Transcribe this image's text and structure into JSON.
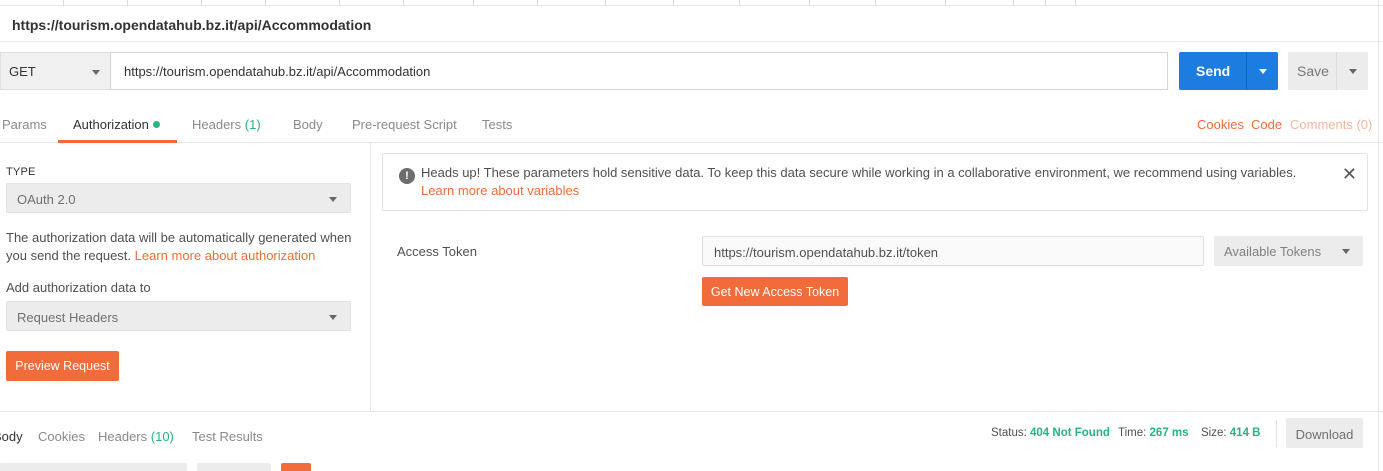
{
  "request": {
    "title": "https://tourism.opendatahub.bz.it/api/Accommodation",
    "method": "GET",
    "url": "https://tourism.opendatahub.bz.it/api/Accommodation",
    "send_label": "Send",
    "save_label": "Save"
  },
  "request_tabs": {
    "params": "Params",
    "authorization": "Authorization",
    "headers": "Headers",
    "headers_count": "(1)",
    "body": "Body",
    "prerequest": "Pre-request Script",
    "tests": "Tests",
    "cookies": "Cookies",
    "code": "Code",
    "comments": "Comments (0)"
  },
  "auth": {
    "type_label": "TYPE",
    "type_value": "OAuth 2.0",
    "description": "The authorization data will be automatically generated when you send the request.",
    "learn_more": "Learn more about authorization",
    "add_to_label": "Add authorization data to",
    "add_to_value": "Request Headers",
    "preview_button": "Preview Request"
  },
  "alert": {
    "message": "Heads up! These parameters hold sensitive data. To keep this data secure while working in a collaborative environment, we recommend using variables.",
    "link": "Learn more about variables",
    "close_glyph": "✕",
    "icon_glyph": "!"
  },
  "token": {
    "label": "Access Token",
    "value": "https://tourism.opendatahub.bz.it/token",
    "available_label": "Available Tokens",
    "get_new_button": "Get New Access Token"
  },
  "response": {
    "tabs": {
      "body": "Body",
      "cookies": "Cookies",
      "headers": "Headers",
      "headers_count": "(10)",
      "test_results": "Test Results"
    },
    "status_label": "Status:",
    "status_value": "404 Not Found",
    "time_label": "Time:",
    "time_value": "267 ms",
    "size_label": "Size:",
    "size_value": "414 B",
    "download_label": "Download"
  },
  "colors": {
    "accent_orange": "#f26b3a",
    "send_blue": "#1c7ce0",
    "status_green": "#26b47f"
  }
}
